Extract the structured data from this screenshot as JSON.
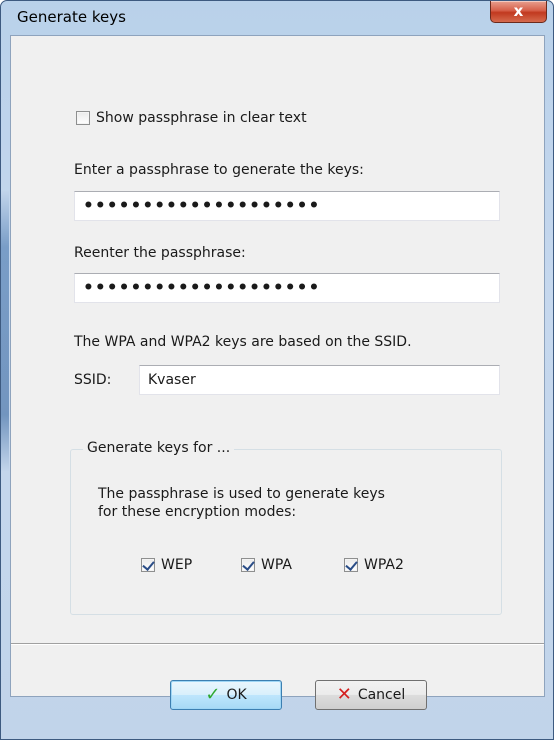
{
  "window": {
    "title": "Generate keys",
    "close_label": "x"
  },
  "options": {
    "show_clear_text_label": "Show passphrase in clear text",
    "show_clear_text_checked": false
  },
  "passphrase": {
    "label": "Enter a passphrase to generate the keys:",
    "value_masked": "••••••••••••••••••••"
  },
  "reenter": {
    "label": "Reenter the passphrase:",
    "value_masked": "••••••••••••••••••••"
  },
  "ssid": {
    "info_text": "The WPA and WPA2 keys are based on the SSID.",
    "label": "SSID:",
    "value": "Kvaser"
  },
  "group": {
    "title": "Generate keys for ...",
    "description_line1": "The passphrase is used to generate keys",
    "description_line2": "for these encryption modes:",
    "modes": [
      {
        "label": "WEP",
        "checked": true
      },
      {
        "label": "WPA",
        "checked": true
      },
      {
        "label": "WPA2",
        "checked": true
      }
    ]
  },
  "buttons": {
    "ok_label": "OK",
    "cancel_label": "Cancel"
  },
  "colors": {
    "ok_icon": "#2fa82f",
    "cancel_icon": "#d42020",
    "title_bar": "#b9d1ea",
    "close_button": "#c1391f"
  },
  "icons": {
    "ok": "checkmark-icon",
    "cancel": "x-icon"
  }
}
